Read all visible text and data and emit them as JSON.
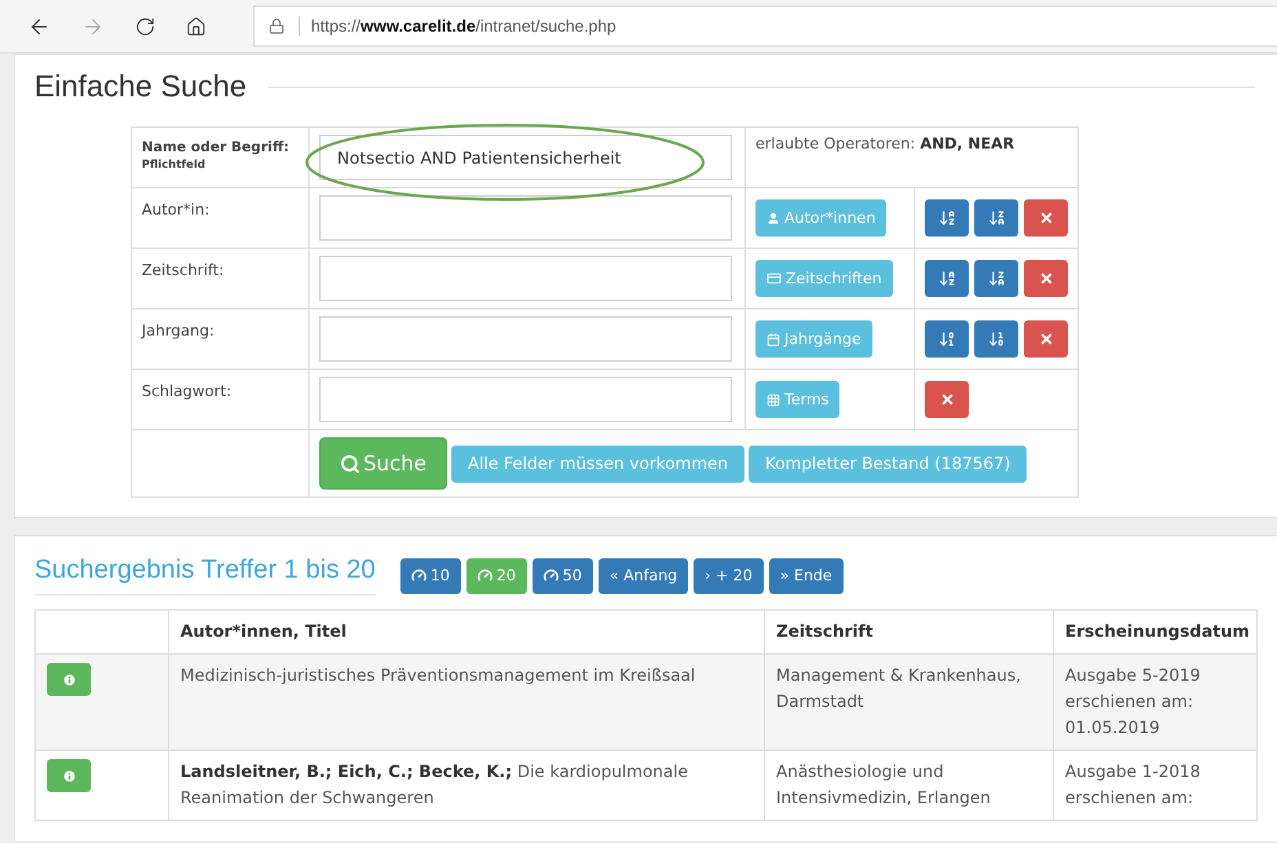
{
  "browser": {
    "url": "https://**www.carelit.de**/intranet/suche.php",
    "back_disabled": false,
    "forward_disabled": true
  },
  "search": {
    "title": "Einfache Suche",
    "fields": [
      {
        "kind": "term",
        "label": "Name oder Begriff:",
        "sublabel": "Pflichtfeld",
        "value": "Notsectio AND Patientensicherheit",
        "highlighted": true,
        "note": "erlaubte Operatoren: **AND, NEAR**"
      },
      {
        "kind": "author",
        "label": "Autor*in:",
        "helper": "Autor*innen"
      },
      {
        "kind": "journal",
        "label": "Zeitschrift:",
        "helper": "Zeitschriften"
      },
      {
        "kind": "year",
        "label": "Jahrgang:",
        "helper": "Jahrgänge"
      },
      {
        "kind": "keyword",
        "label": "Schlagwort:",
        "helper": "Terms"
      }
    ],
    "submit": "Suche",
    "buttons": [
      "Alle Felder müssen vorkommen",
      "Kompletter Bestand (187567)"
    ]
  },
  "results": {
    "title": "Suchergebnis Treffer 1 bis 20",
    "pager": [
      {
        "kind": "per_page",
        "label": "10",
        "selected": false
      },
      {
        "kind": "per_page",
        "label": "20",
        "selected": true
      },
      {
        "kind": "per_page",
        "label": "50",
        "selected": false
      },
      {
        "kind": "nav",
        "label": "« Anfang",
        "selected": false
      },
      {
        "kind": "nav",
        "label": "› + 20",
        "selected": false
      },
      {
        "kind": "nav",
        "label": "» Ende",
        "selected": false
      }
    ],
    "columns": [
      "Autor*innen, Titel",
      "Zeitschrift",
      "Erscheinungsdatum"
    ],
    "rows": [
      {
        "title": "Medizinisch-juristisches Präventionsmanagement im Kreißsaal",
        "journal": [
          "Management & Krankenhaus,",
          "Darmstadt"
        ],
        "date": [
          "Ausgabe 5-2019",
          "erschienen am:",
          "01.05.2019"
        ]
      },
      {
        "title": "**Landsleitner, B.; Eich, C.; Becke, K.;** Die kardiopulmonale Reanimation der Schwangeren",
        "journal": [
          "Anästhesiologie und",
          "Intensivmedizin, Erlangen"
        ],
        "date": [
          "Ausgabe 1-2018",
          "erschienen am:"
        ]
      }
    ]
  }
}
